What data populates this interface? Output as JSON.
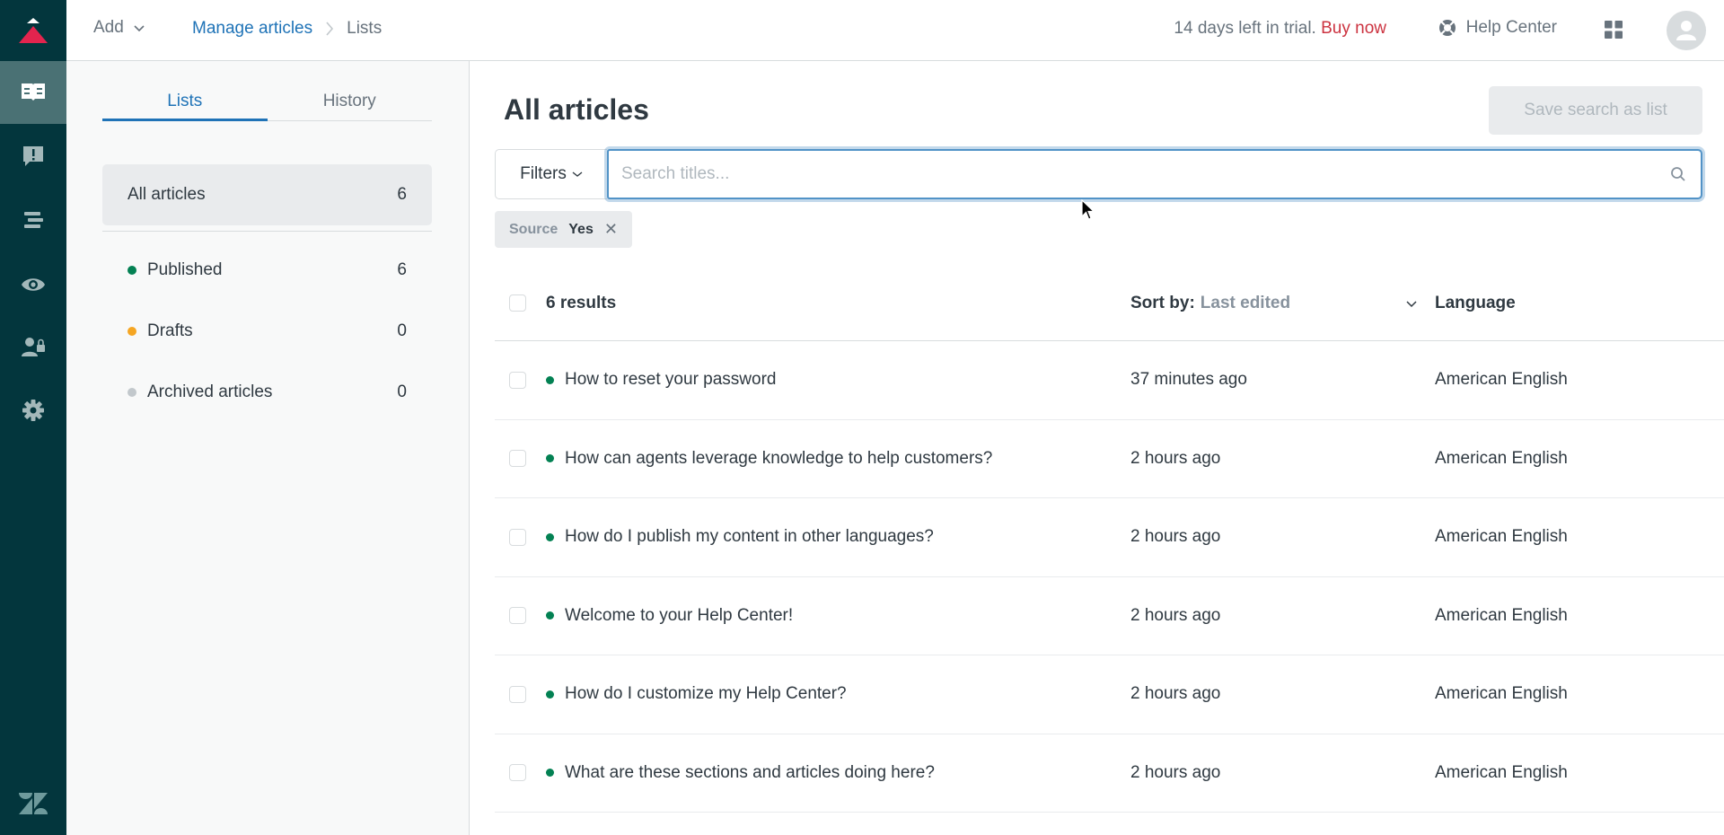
{
  "header": {
    "add_label": "Add",
    "breadcrumb": {
      "parent": "Manage articles",
      "current": "Lists"
    },
    "trial_text": "14 days left in trial.",
    "buy_now": "Buy now",
    "help_center": "Help Center"
  },
  "rail": {
    "items": [
      {
        "icon": "knowledge-book-icon",
        "active": true
      },
      {
        "icon": "feedback-alert-icon",
        "active": false
      },
      {
        "icon": "sections-arrange-icon",
        "active": false
      },
      {
        "icon": "eye-preview-icon",
        "active": false
      },
      {
        "icon": "user-permissions-icon",
        "active": false
      },
      {
        "icon": "gear-icon",
        "active": false
      }
    ]
  },
  "panel": {
    "tabs": [
      {
        "label": "Lists",
        "active": true
      },
      {
        "label": "History",
        "active": false
      }
    ],
    "all_articles": {
      "label": "All articles",
      "count": "6"
    },
    "lists": [
      {
        "label": "Published",
        "count": "6",
        "color": "#038153"
      },
      {
        "label": "Drafts",
        "count": "0",
        "color": "#f5a623"
      },
      {
        "label": "Archived articles",
        "count": "0",
        "color": "#c2c8cc"
      }
    ]
  },
  "main": {
    "title": "All articles",
    "save_search": "Save search as list",
    "filters_label": "Filters",
    "search": {
      "value": "",
      "placeholder": "Search titles..."
    },
    "chip": {
      "key": "Source",
      "value": "Yes"
    },
    "table": {
      "results_label": "6 results",
      "sort_key": "Sort by:",
      "sort_value": "Last edited",
      "language_header": "Language",
      "rows": [
        {
          "title": "How to reset your password",
          "edited": "37 minutes ago",
          "language": "American English"
        },
        {
          "title": "How can agents leverage knowledge to help customers?",
          "edited": "2 hours ago",
          "language": "American English"
        },
        {
          "title": "How do I publish my content in other languages?",
          "edited": "2 hours ago",
          "language": "American English"
        },
        {
          "title": "Welcome to your Help Center!",
          "edited": "2 hours ago",
          "language": "American English"
        },
        {
          "title": "How do I customize my Help Center?",
          "edited": "2 hours ago",
          "language": "American English"
        },
        {
          "title": "What are these sections and articles doing here?",
          "edited": "2 hours ago",
          "language": "American English"
        }
      ]
    }
  },
  "colors": {
    "rail_bg": "#03363d",
    "accent_blue": "#1f73b7",
    "buy_now_red": "#cc3340",
    "published_green": "#038153"
  }
}
